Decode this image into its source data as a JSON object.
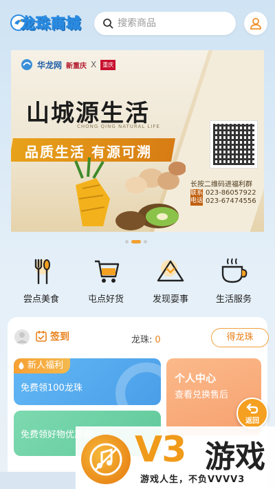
{
  "header": {
    "app_name": "龙珠商城",
    "search_placeholder": "搜索商品"
  },
  "banner": {
    "brand_1": "华龙网",
    "brand_2": "新重庆",
    "brand_sep": "X",
    "brand_3": "重庆",
    "title": "山城源生活",
    "subtitle_left": "CHONG QING",
    "subtitle_right": "NATURAL LIFE",
    "slogan": "品质生活  有源可溯",
    "qr_tip": "长按二维码进福利群",
    "contact_label": "联系电话",
    "phone_1": "023-86057922",
    "phone_2": "023-67474556"
  },
  "carousel": {
    "count": 3,
    "active": 1
  },
  "categories": [
    {
      "label": "尝点美食",
      "icon": "fork-spoon-icon"
    },
    {
      "label": "屯点好货",
      "icon": "shopping-cart-icon"
    },
    {
      "label": "发现耍事",
      "icon": "mountain-icon"
    },
    {
      "label": "生活服务",
      "icon": "coffee-cup-icon"
    }
  ],
  "checkin": {
    "label": "签到",
    "dragon_label": "龙珠:",
    "dragon_count": "0",
    "get_button": "得龙珠"
  },
  "tiles": {
    "welfare_tag": "新人福利",
    "welfare_desc": "免费领100龙珠",
    "personal_title": "个人中心",
    "personal_desc": "查看兑换售后",
    "goods_desc": "免费领好物优惠卷"
  },
  "back_button": "返回",
  "watermark": {
    "brand": "V3",
    "game": "游戏",
    "slogan": "游戏人生，不负VVVV3"
  },
  "colors": {
    "accent": "#e8801a",
    "welfare_blue": "#4a9ee8",
    "personal_orange": "#f7a06e",
    "goods_green": "#5fc99b"
  }
}
